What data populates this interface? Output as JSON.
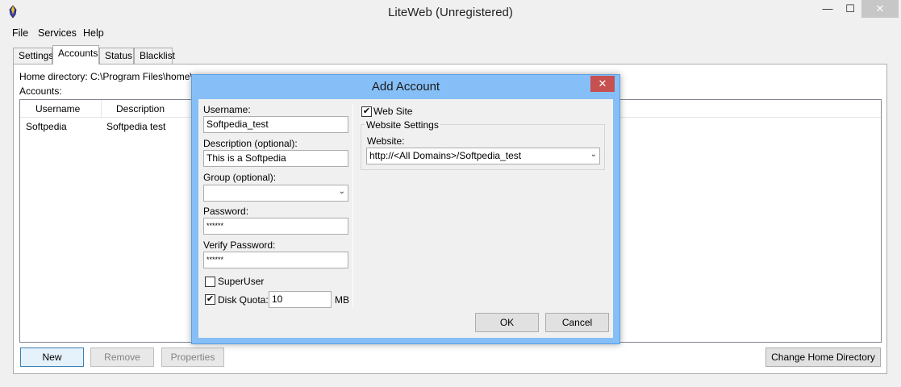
{
  "window": {
    "title": "LiteWeb (Unregistered)",
    "min_glyph": "—",
    "max_glyph": "☐",
    "close_glyph": "✕"
  },
  "menu": [
    "File",
    "Services",
    "Help"
  ],
  "tabs": [
    "Settings",
    "Accounts",
    "Status",
    "Blacklist"
  ],
  "active_tab": "Accounts",
  "accounts": {
    "home_directory_label": "Home directory: C:\\Program Files\\home\\",
    "accounts_label": "Accounts:",
    "columns": [
      "Username",
      "Description"
    ],
    "rows": [
      {
        "username": "Softpedia",
        "description": "Softpedia test"
      }
    ],
    "buttons": {
      "new": "New",
      "remove": "Remove",
      "properties": "Properties",
      "change_home": "Change Home Directory"
    }
  },
  "dialog": {
    "title": "Add Account",
    "close_glyph": "✕",
    "username_label": "Username:",
    "username_value": "Softpedia_test",
    "description_label": "Description (optional):",
    "description_value": "This is a Softpedia",
    "group_label": "Group (optional):",
    "group_value": "",
    "password_label": "Password:",
    "password_value": "******",
    "verify_label": "Verify Password:",
    "verify_value": "******",
    "superuser_label": "SuperUser",
    "superuser_checked": false,
    "disk_quota_label": "Disk Quota:",
    "disk_quota_checked": true,
    "disk_quota_value": "10",
    "disk_quota_unit": "MB",
    "website_checkbox_label": "Web Site",
    "website_checked": true,
    "website_settings_title": "Website Settings",
    "website_label": "Website:",
    "website_value": "http://<All Domains>/Softpedia_test",
    "ok": "OK",
    "cancel": "Cancel",
    "check_glyph": "✔",
    "arrow_glyph": "⌄"
  }
}
